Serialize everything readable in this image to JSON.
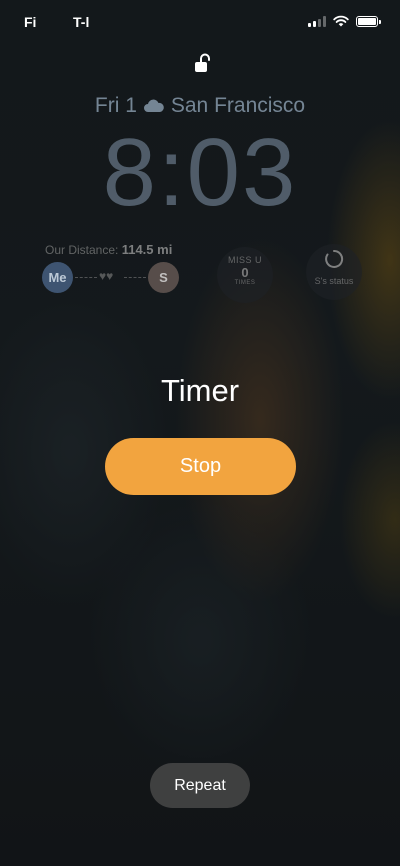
{
  "status_bar": {
    "left_text_1": "Fi",
    "left_text_2": "T-l",
    "icons": [
      "signal-icon",
      "wifi-icon",
      "battery-icon"
    ]
  },
  "lock_state": {
    "icon": "unlocked-padlock-icon"
  },
  "lockscreen": {
    "day": "Fri 1",
    "weather_icon": "cloud-icon",
    "city": "San Francisco",
    "time": "8:03"
  },
  "widgets": {
    "distance": {
      "label": "Our Distance:",
      "value": "114.5 mi",
      "me_label": "Me",
      "partner_label": "S",
      "hearts": "♥♥"
    },
    "miss_u": {
      "title": "MISS U",
      "count": "0",
      "unit": "TIMES"
    },
    "status": {
      "label": "S's status",
      "icon": "loading-ring-icon"
    }
  },
  "alert": {
    "title": "Timer",
    "stop_label": "Stop",
    "repeat_label": "Repeat"
  },
  "colors": {
    "accent": "#f2a43f",
    "repeat_bg": "#4b4b4b"
  }
}
